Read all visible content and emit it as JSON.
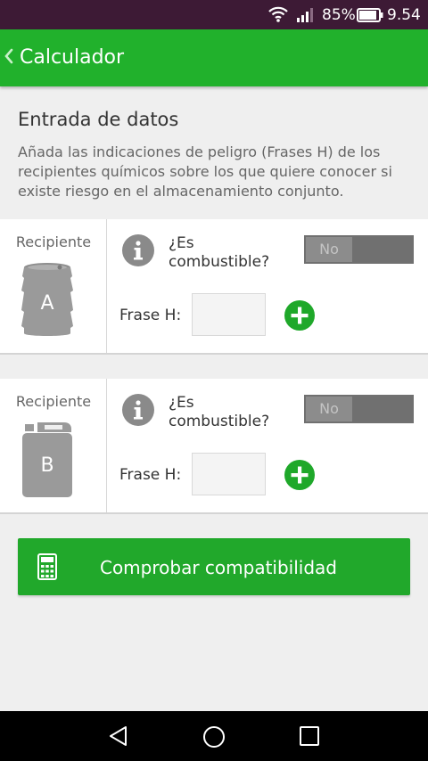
{
  "status_bar": {
    "battery_percent": "85%",
    "time": "9.54",
    "icons": [
      "wifi-icon",
      "signal-icon",
      "battery-icon"
    ]
  },
  "app_bar": {
    "back_glyph": "❮",
    "title": "Calculador"
  },
  "intro": {
    "title": "Entrada de datos",
    "description": "Añada las indicaciones de peligro (Frases H) de los recipientes químicos sobre los que quiere conocer si existe riesgo en el almacenamiento conjunto."
  },
  "containers": [
    {
      "label": "Recipiente",
      "letter": "A",
      "icon": "barrel-icon",
      "question_line1": "¿Es",
      "question_line2": "combustible?",
      "toggle_value": "No",
      "frase_label": "Frase H:",
      "frase_value": ""
    },
    {
      "label": "Recipiente",
      "letter": "B",
      "icon": "jerrycan-icon",
      "question_line1": "¿Es",
      "question_line2": "combustible?",
      "toggle_value": "No",
      "frase_label": "Frase H:",
      "frase_value": ""
    }
  ],
  "action": {
    "label": "Comprobar compatibilidad",
    "icon": "calculator-icon"
  },
  "colors": {
    "accent": "#21b12c",
    "status_bar": "#3d1a35",
    "toggle_off": "#707070"
  }
}
